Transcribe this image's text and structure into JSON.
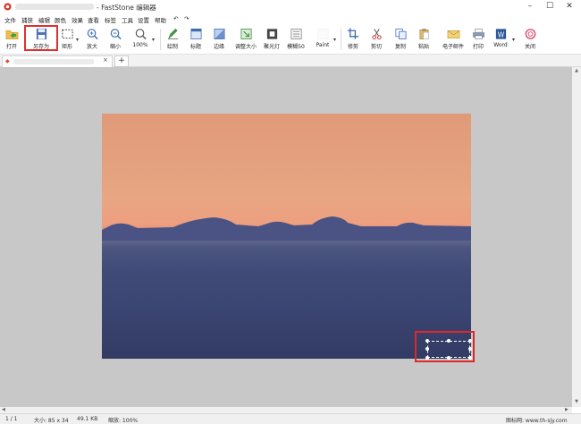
{
  "window": {
    "title": "- FastStone 编辑器",
    "buttons": [
      "–",
      "☐",
      "✕"
    ]
  },
  "menu": [
    "文件",
    "捕获",
    "编辑",
    "颜色",
    "效果",
    "查看",
    "标签",
    "工具",
    "设置",
    "帮助",
    "↶",
    "↷"
  ],
  "toolbar": {
    "open": "打开",
    "save_as": "另存为",
    "rect": "矩形",
    "zoom_in": "放大",
    "zoom_out": "缩小",
    "zoom": "100%",
    "draw": "绘制",
    "caption": "标题",
    "edge": "边缘",
    "resize": "调整大小",
    "spotlight": "聚光灯",
    "blur": "模糊50",
    "paint": "Paint",
    "crop": "修剪",
    "cut": "剪切",
    "copy": "复制",
    "paste": "粘贴",
    "email": "电子邮件",
    "print": "打印",
    "word": "Word",
    "close": "关闭"
  },
  "tabs": {
    "add": "+",
    "close": "×"
  },
  "status": {
    "page": "1 / 1",
    "size": "大小: 85 x 34",
    "filesize": "49.1 KB",
    "zoom": "缩放: 100%",
    "brand": "图标网: www.th-sjy.com"
  },
  "colors": {
    "highlight": "#e03030",
    "canvas_bg": "#c8c8c8"
  }
}
